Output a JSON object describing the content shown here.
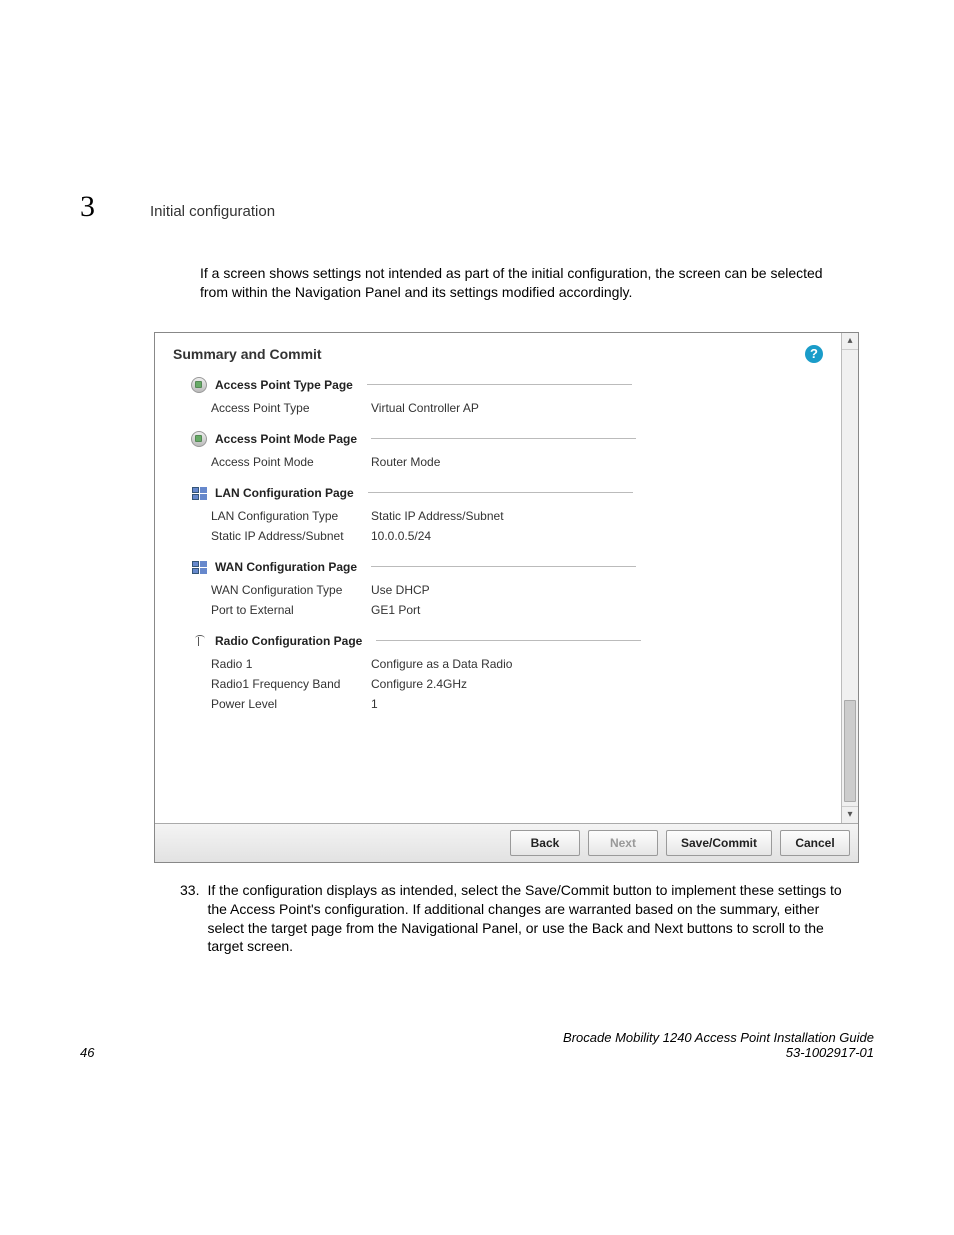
{
  "chapter": {
    "number": "3",
    "title": "Initial configuration"
  },
  "intro": "If a screen shows settings not intended as part of the initial configuration, the screen can be selected from within the Navigation Panel and its settings modified accordingly.",
  "panel": {
    "title": "Summary and Commit",
    "sections": [
      {
        "icon": "circle",
        "title": "Access Point Type Page",
        "rows": [
          {
            "k": "Access Point Type",
            "v": "Virtual Controller AP"
          }
        ]
      },
      {
        "icon": "circle",
        "title": "Access Point Mode Page",
        "rows": [
          {
            "k": "Access Point Mode",
            "v": "Router Mode"
          }
        ]
      },
      {
        "icon": "net",
        "title": "LAN Configuration Page",
        "rows": [
          {
            "k": "LAN Configuration Type",
            "v": "Static IP Address/Subnet"
          },
          {
            "k": "Static IP Address/Subnet",
            "v": "10.0.0.5/24"
          }
        ]
      },
      {
        "icon": "net",
        "title": "WAN Configuration Page",
        "rows": [
          {
            "k": "WAN Configuration Type",
            "v": "Use DHCP"
          },
          {
            "k": "Port to External",
            "v": "GE1 Port"
          }
        ]
      },
      {
        "icon": "radio",
        "title": "Radio Configuration Page",
        "rows": [
          {
            "k": "Radio 1",
            "v": "Configure as a Data Radio"
          },
          {
            "k": "Radio1 Frequency Band",
            "v": "Configure 2.4GHz"
          },
          {
            "k": "Power Level",
            "v": "1"
          }
        ]
      }
    ],
    "buttons": {
      "back": "Back",
      "next": "Next",
      "save": "Save/Commit",
      "cancel": "Cancel"
    }
  },
  "step": {
    "number": "33.",
    "pre": "If the configuration displays as intended, select the ",
    "em1": "Save/Commit",
    "mid": " button to implement these settings to the Access Point's configuration. If additional changes are warranted based on the summary, either select the target page from the Navigational Panel, or use the ",
    "em2": "Back",
    "and": " and ",
    "em3": "Next",
    "post": " buttons to scroll to the target screen."
  },
  "footer": {
    "page": "46",
    "guide": "Brocade Mobility 1240 Access Point Installation Guide",
    "docnum": "53-1002917-01"
  }
}
